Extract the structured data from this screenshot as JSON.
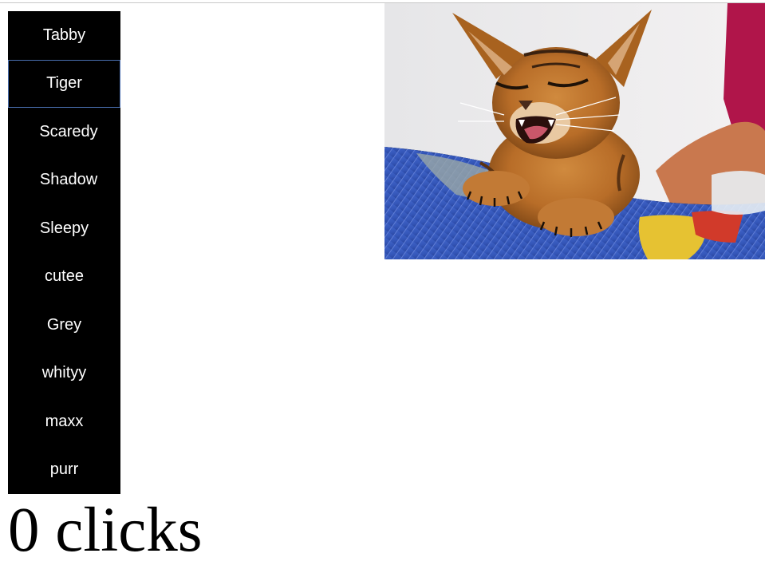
{
  "cat_list": {
    "items": [
      {
        "label": "Tabby"
      },
      {
        "label": "Tiger"
      },
      {
        "label": "Scaredy"
      },
      {
        "label": "Shadow"
      },
      {
        "label": "Sleepy"
      },
      {
        "label": "cutee"
      },
      {
        "label": "Grey"
      },
      {
        "label": "whityy"
      },
      {
        "label": "maxx"
      },
      {
        "label": "purr"
      }
    ],
    "focused_item": "Tiger"
  },
  "counter": {
    "text": "0 clicks"
  },
  "photo": {
    "subject": "orange tabby kitten yawning on a blue patterned blanket",
    "icon": "cat-photo"
  },
  "colors": {
    "list_background": "#000000",
    "list_text": "#ffffff",
    "focus_outline": "#4a6fb0",
    "page_background": "#ffffff"
  }
}
